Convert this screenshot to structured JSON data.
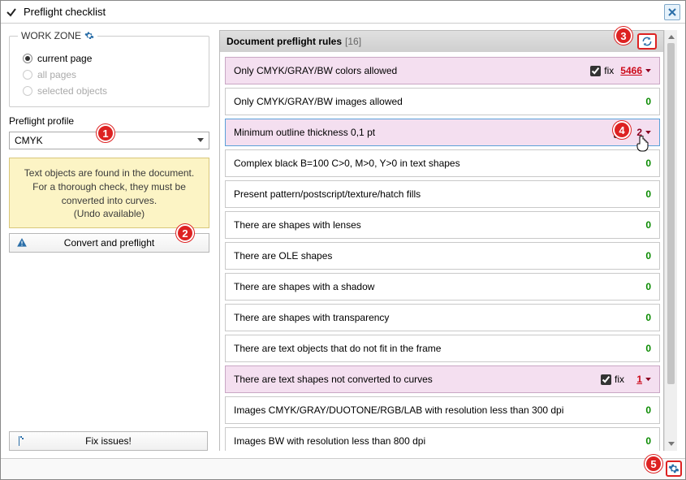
{
  "window": {
    "title": "Preflight checklist"
  },
  "workzone": {
    "legend": "WORK ZONE",
    "current": "current page",
    "all": "all pages",
    "selected": "selected objects"
  },
  "profile": {
    "label": "Preflight profile",
    "value": "CMYK"
  },
  "info": {
    "line1": "Text objects are found in the document.",
    "line2": "For a thorough check, they must be",
    "line3": "converted into curves.",
    "undo": "(Undo available)",
    "button": "Convert and preflight"
  },
  "fix_issues": "Fix issues!",
  "rules": {
    "heading": "Document preflight rules",
    "count": "[16]",
    "fix_label": "fix",
    "items": [
      {
        "text": "Only CMYK/GRAY/BW colors allowed",
        "fix": true,
        "count": "5466",
        "style": "red",
        "hl": true,
        "caret": true
      },
      {
        "text": "Only CMYK/GRAY/BW images allowed",
        "count": "0",
        "style": "green"
      },
      {
        "text": "Minimum outline thickness 0,1 pt",
        "fix": true,
        "count": "2",
        "style": "dark",
        "hl": true,
        "active": true,
        "caret": true,
        "fix_hidden": true
      },
      {
        "text": "Complex black B=100  C>0, M>0, Y>0 in text shapes",
        "count": "0",
        "style": "green"
      },
      {
        "text": "Present pattern/postscript/texture/hatch fills",
        "count": "0",
        "style": "green"
      },
      {
        "text": "There are shapes with lenses",
        "count": "0",
        "style": "green"
      },
      {
        "text": "There are OLE shapes",
        "count": "0",
        "style": "green"
      },
      {
        "text": "There are shapes with a shadow",
        "count": "0",
        "style": "green"
      },
      {
        "text": "There are shapes with transparency",
        "count": "0",
        "style": "green"
      },
      {
        "text": "There are text objects that do not fit in the frame",
        "count": "0",
        "style": "green"
      },
      {
        "text": "There are text shapes not converted to curves",
        "fix": true,
        "count": "1",
        "style": "red",
        "hl": true,
        "caret": true
      },
      {
        "text": "Images CMYK/GRAY/DUOTONE/RGB/LAB with resolution less than 300 dpi",
        "count": "0",
        "style": "green"
      },
      {
        "text": "Images BW with resolution less than 800 dpi",
        "count": "0",
        "style": "green"
      }
    ]
  },
  "callouts": {
    "c1": "1",
    "c2": "2",
    "c3": "3",
    "c4": "4",
    "c5": "5"
  }
}
